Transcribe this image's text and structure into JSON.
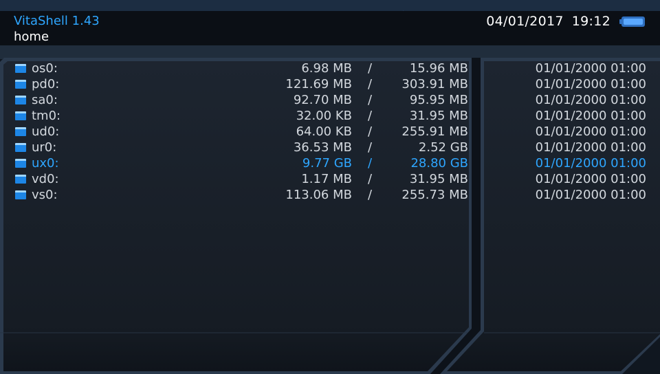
{
  "header": {
    "app_title": "VitaShell 1.43",
    "path": "home",
    "date": "04/01/2017",
    "time": "19:12",
    "battery_icon": "battery-icon",
    "battery_level": 1.0
  },
  "colors": {
    "accent": "#2ea6ff",
    "text": "#d3d8de",
    "background": "#0f151e",
    "panel": "#1a212b"
  },
  "files": [
    {
      "name": "os0:",
      "free": "6.98 MB",
      "sep": "/",
      "total": "15.96 MB",
      "date": "01/01/2000 01:00",
      "icon": "folder-icon",
      "selected": false
    },
    {
      "name": "pd0:",
      "free": "121.69 MB",
      "sep": "/",
      "total": "303.91 MB",
      "date": "01/01/2000 01:00",
      "icon": "folder-icon",
      "selected": false
    },
    {
      "name": "sa0:",
      "free": "92.70 MB",
      "sep": "/",
      "total": "95.95 MB",
      "date": "01/01/2000 01:00",
      "icon": "folder-icon",
      "selected": false
    },
    {
      "name": "tm0:",
      "free": "32.00 KB",
      "sep": "/",
      "total": "31.95 MB",
      "date": "01/01/2000 01:00",
      "icon": "folder-icon",
      "selected": false
    },
    {
      "name": "ud0:",
      "free": "64.00 KB",
      "sep": "/",
      "total": "255.91 MB",
      "date": "01/01/2000 01:00",
      "icon": "folder-icon",
      "selected": false
    },
    {
      "name": "ur0:",
      "free": "36.53 MB",
      "sep": "/",
      "total": "2.52 GB",
      "date": "01/01/2000 01:00",
      "icon": "folder-icon",
      "selected": false
    },
    {
      "name": "ux0:",
      "free": "9.77 GB",
      "sep": "/",
      "total": "28.80 GB",
      "date": "01/01/2000 01:00",
      "icon": "folder-icon",
      "selected": true
    },
    {
      "name": "vd0:",
      "free": "1.17 MB",
      "sep": "/",
      "total": "31.95 MB",
      "date": "01/01/2000 01:00",
      "icon": "folder-icon",
      "selected": false
    },
    {
      "name": "vs0:",
      "free": "113.06 MB",
      "sep": "/",
      "total": "255.73 MB",
      "date": "01/01/2000 01:00",
      "icon": "folder-icon",
      "selected": false
    }
  ]
}
